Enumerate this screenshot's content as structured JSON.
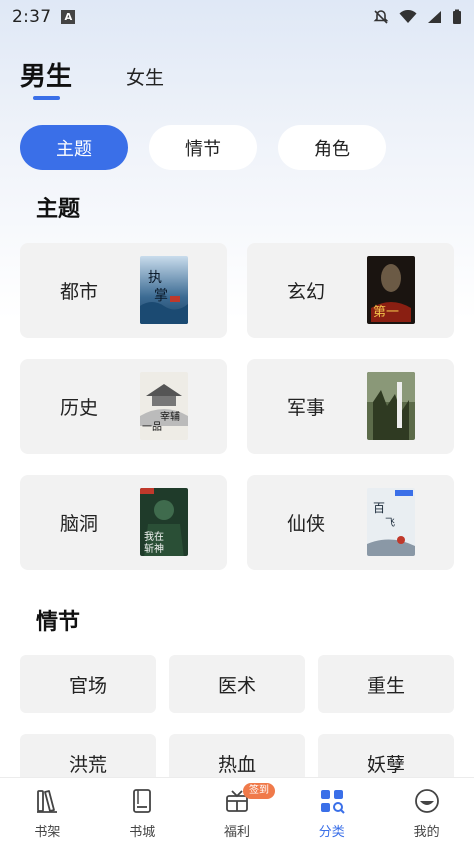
{
  "status_bar": {
    "time": "2:37",
    "a_badge": "A"
  },
  "gender_tabs": [
    {
      "label": "男生",
      "active": true
    },
    {
      "label": "女生",
      "active": false
    }
  ],
  "filters": [
    {
      "label": "主题",
      "active": true
    },
    {
      "label": "情节",
      "active": false
    },
    {
      "label": "角色",
      "active": false
    }
  ],
  "sections": {
    "theme_title": "主题",
    "plot_title": "情节"
  },
  "themes": [
    {
      "label": "都市",
      "cover": "blue-ocean-cover"
    },
    {
      "label": "玄幻",
      "cover": "dark-red-cover"
    },
    {
      "label": "历史",
      "cover": "ink-palace-cover"
    },
    {
      "label": "军事",
      "cover": "military-green-cover"
    },
    {
      "label": "脑洞",
      "cover": "green-warrior-cover"
    },
    {
      "label": "仙侠",
      "cover": "ink-immortal-cover"
    }
  ],
  "plots": [
    {
      "label": "官场"
    },
    {
      "label": "医术"
    },
    {
      "label": "重生"
    },
    {
      "label": "洪荒"
    },
    {
      "label": "热血"
    },
    {
      "label": "妖孽"
    }
  ],
  "bottom_nav": [
    {
      "label": "书架",
      "icon": "bookshelf-icon",
      "active": false
    },
    {
      "label": "书城",
      "icon": "book-icon",
      "active": false
    },
    {
      "label": "福利",
      "icon": "gift-icon",
      "active": false,
      "badge": "签到"
    },
    {
      "label": "分类",
      "icon": "category-icon",
      "active": true
    },
    {
      "label": "我的",
      "icon": "profile-icon",
      "active": false
    }
  ],
  "colors": {
    "accent": "#3a6fe8",
    "card_bg": "#f2f2f2",
    "badge": "#f07a4a"
  }
}
